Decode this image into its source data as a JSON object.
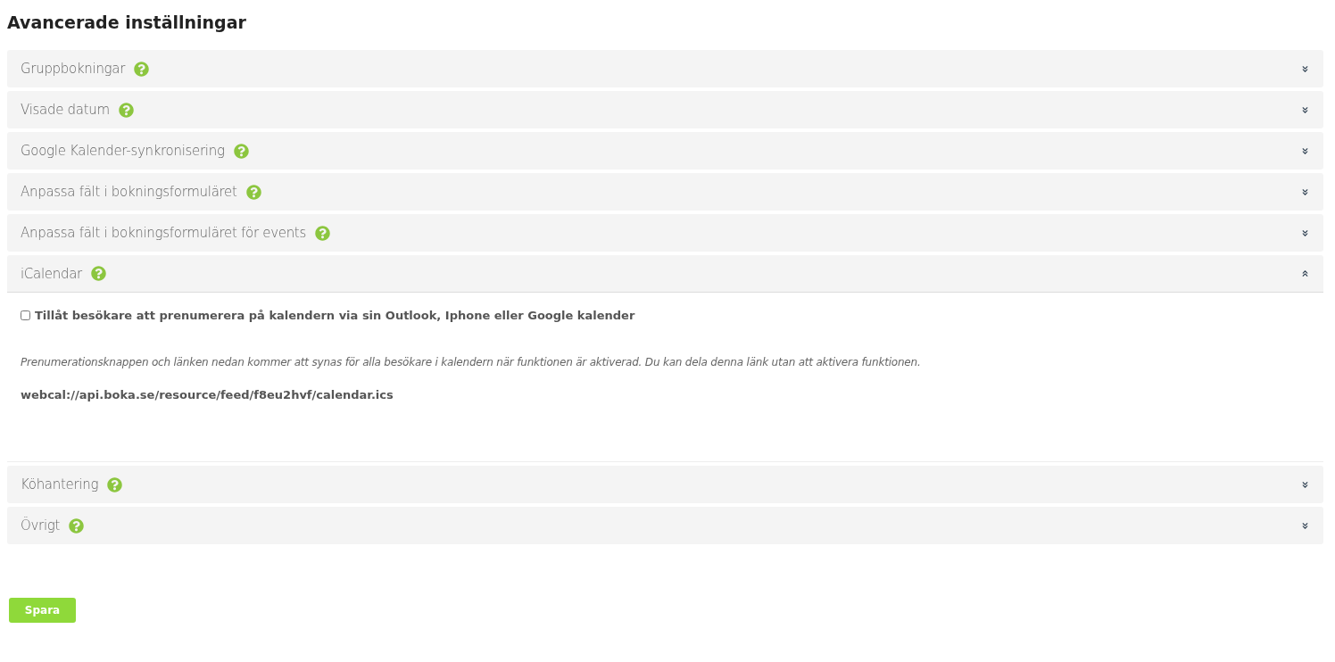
{
  "title": "Avancerade inställningar",
  "sections": [
    {
      "label": "Gruppbokningar",
      "expanded": false
    },
    {
      "label": "Visade datum",
      "expanded": false
    },
    {
      "label": "Google Kalender-synkronisering",
      "expanded": false
    },
    {
      "label": "Anpassa fält i bokningsformuläret",
      "expanded": false
    },
    {
      "label": "Anpassa fält i bokningsformuläret för events",
      "expanded": false
    },
    {
      "label": "iCalendar",
      "expanded": true,
      "content": {
        "checkbox": {
          "label": "Tillåt besökare att prenumerera på kalendern via sin Outlook, Iphone eller Google kalender",
          "checked": false
        },
        "note": "Prenumerationsknappen och länken nedan kommer att synas för alla besökare i kalendern när funktionen är aktiverad. Du kan dela denna länk utan att aktivera funktionen.",
        "url": "webcal://api.boka.se/resource/feed/f8eu2hvf/calendar.ics"
      }
    },
    {
      "label": "Köhantering",
      "expanded": false
    },
    {
      "label": "Övrigt",
      "expanded": false
    }
  ],
  "save_button": "Spara"
}
